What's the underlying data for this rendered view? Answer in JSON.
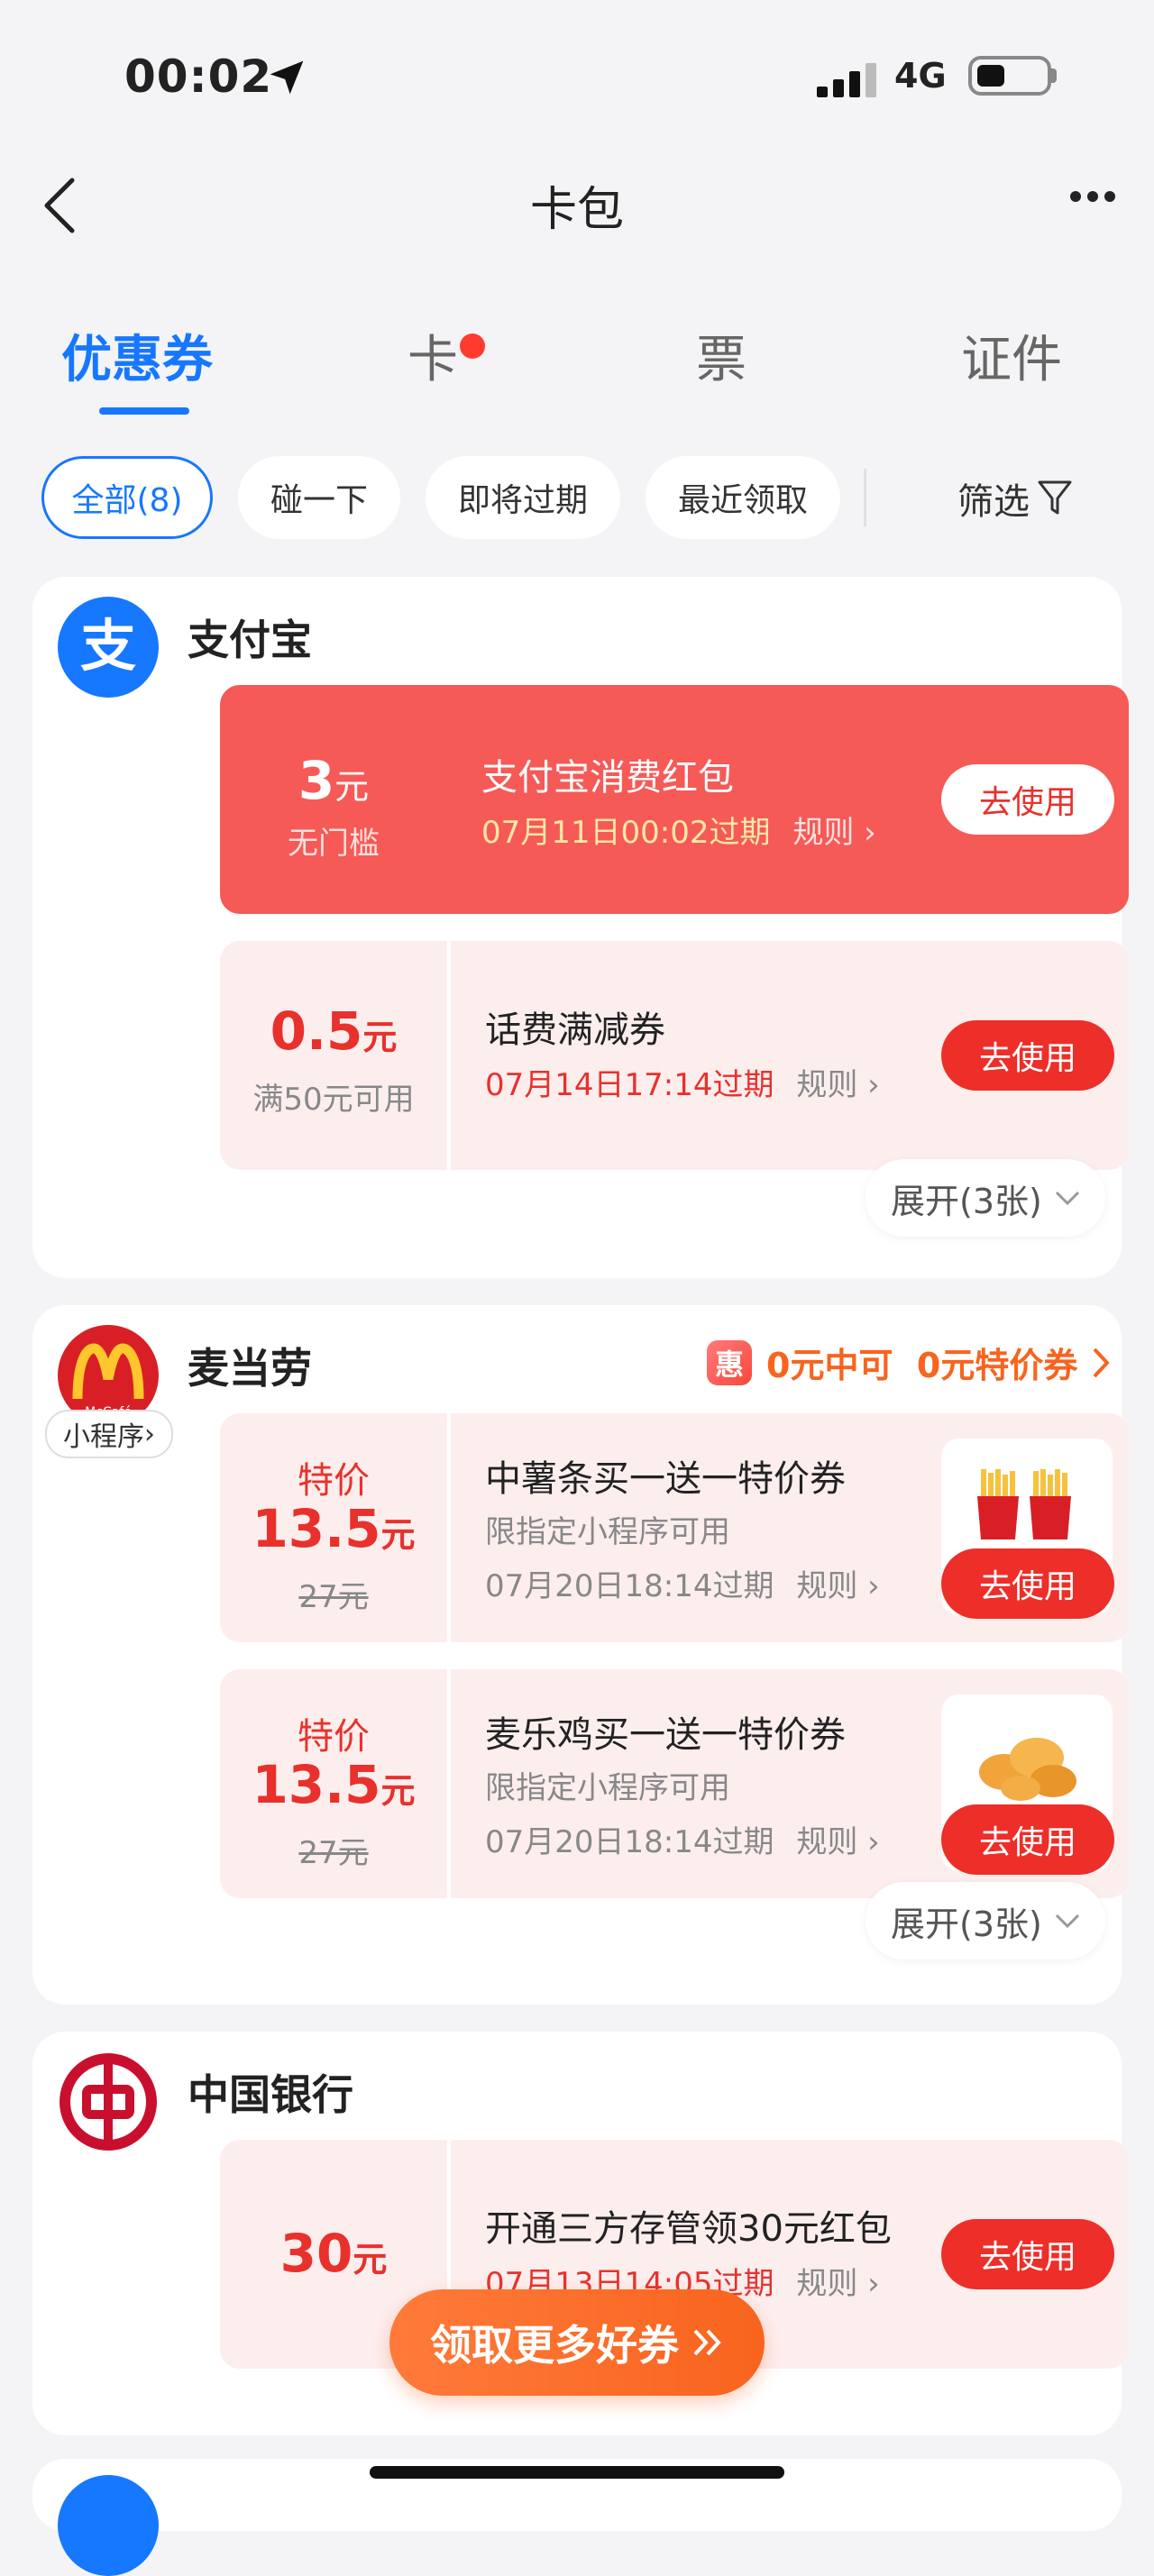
{
  "status_bar": {
    "time": "00:02",
    "network": "4G"
  },
  "nav": {
    "title": "卡包"
  },
  "tabs": [
    {
      "label": "优惠券",
      "active": true
    },
    {
      "label": "卡",
      "has_dot": true
    },
    {
      "label": "票"
    },
    {
      "label": "证件"
    }
  ],
  "filters": {
    "chips": [
      "全部(8)",
      "碰一下",
      "即将过期",
      "最近领取"
    ],
    "filter_label": "筛选"
  },
  "merchants": [
    {
      "name": "支付宝",
      "coupons": [
        {
          "amount": "3",
          "unit": "元",
          "condition": "无门槛",
          "title": "支付宝消费红包",
          "expiry": "07月11日00:02过期",
          "rule": "规则",
          "button": "去使用"
        },
        {
          "amount": "0.5",
          "unit": "元",
          "condition": "满50元可用",
          "title": "话费满减券",
          "expiry": "07月14日17:14过期",
          "rule": "规则",
          "button": "去使用"
        }
      ],
      "expand": "展开(3张)"
    },
    {
      "name": "麦当劳",
      "mini_program": "小程序",
      "promo_badge": "惠",
      "promo": "0元中可  0元特价券",
      "coupons": [
        {
          "tag": "特价",
          "amount": "13.5",
          "unit": "元",
          "original": "27元",
          "title": "中薯条买一送一特价券",
          "sub": "限指定小程序可用",
          "expiry": "07月20日18:14过期",
          "rule": "规则",
          "button": "去使用"
        },
        {
          "tag": "特价",
          "amount": "13.5",
          "unit": "元",
          "original": "27元",
          "title": "麦乐鸡买一送一特价券",
          "sub": "限指定小程序可用",
          "expiry": "07月20日18:14过期",
          "rule": "规则",
          "button": "去使用"
        }
      ],
      "expand": "展开(3张)"
    },
    {
      "name": "中国银行",
      "coupons": [
        {
          "amount": "30",
          "unit": "元",
          "title": "开通三方存管领30元红包",
          "expiry": "07月13日14:05过期",
          "rule": "规则",
          "button": "去使用"
        }
      ]
    }
  ],
  "cta": {
    "label": "领取更多好券"
  },
  "colors": {
    "accent": "#1677ff",
    "red": "#ee2e28",
    "orange": "#f8641e"
  }
}
